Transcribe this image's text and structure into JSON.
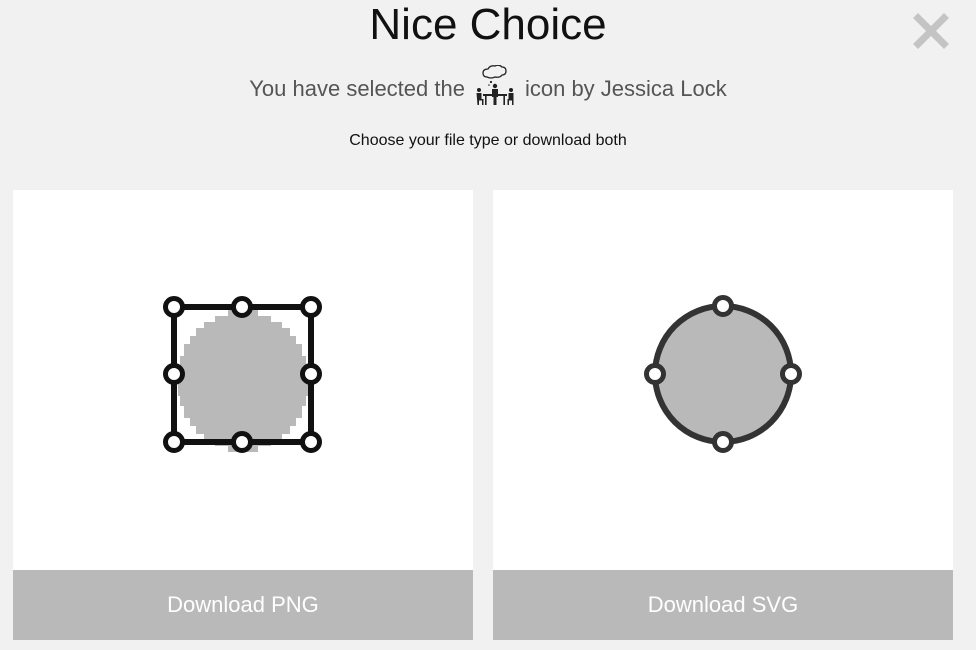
{
  "dialog": {
    "title": "Nice Choice",
    "subtitle_prefix": "You have selected the",
    "subtitle_suffix": "icon by Jessica Lock",
    "instruction": "Choose your file type or download both",
    "selected_icon": "meeting-people-table-icon",
    "close_icon": "close-icon"
  },
  "options": {
    "png": {
      "preview_icon": "png-raster-preview-icon",
      "button_label": "Download PNG"
    },
    "svg": {
      "preview_icon": "svg-vector-preview-icon",
      "button_label": "Download SVG"
    }
  },
  "colors": {
    "background": "#f1f1f1",
    "card": "#ffffff",
    "button": "#b9b9b9",
    "button_text": "#ffffff",
    "preview_fill": "#b9b9b9"
  }
}
